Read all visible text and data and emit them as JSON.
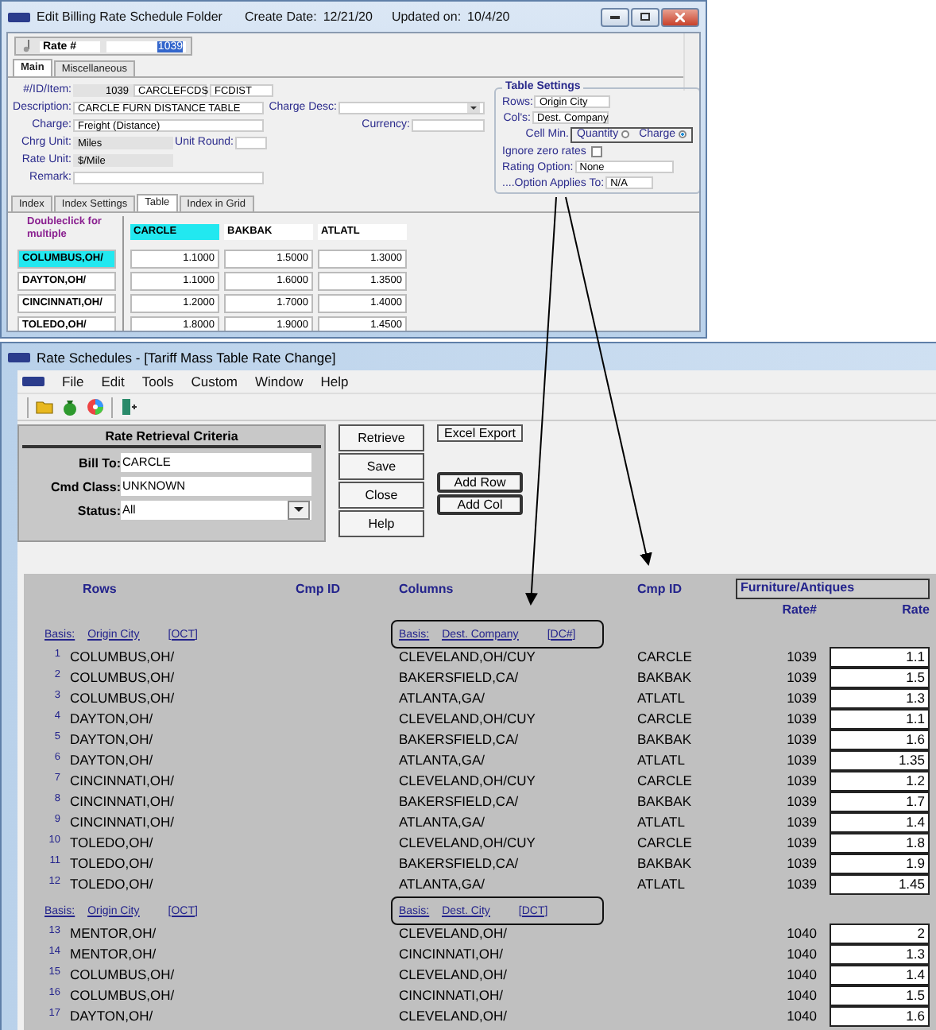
{
  "edit_window": {
    "title": "Edit Billing Rate Schedule Folder",
    "create_label": "Create Date:",
    "create_date": "12/21/20",
    "updated_label": "Updated on:",
    "updated_date": "10/4/20",
    "rate_label": "Rate #",
    "rate_value": "1039",
    "tabs": [
      {
        "label": "Main",
        "selected": true
      },
      {
        "label": "Miscellaneous",
        "selected": false
      }
    ],
    "id_item": {
      "label": "#/ID/Item:",
      "number": "1039",
      "code": "CARCLEFCDS",
      "item": "FCDIST"
    },
    "description": {
      "label": "Description:",
      "value": "CARCLE FURN DISTANCE TABLE"
    },
    "charge_desc": {
      "label": "Charge Desc:"
    },
    "charge": {
      "label": "Charge:",
      "value": "Freight (Distance)"
    },
    "currency": {
      "label": "Currency:"
    },
    "chrg_unit": {
      "label": "Chrg Unit:",
      "value": "Miles"
    },
    "unit_round": {
      "label": "Unit Round:"
    },
    "rate_unit": {
      "label": "Rate Unit:",
      "value": "$/Mile"
    },
    "remark": {
      "label": "Remark:"
    },
    "table_settings": {
      "title": "Table Settings",
      "rows_label": "Rows:",
      "rows_value": "Origin City",
      "cols_label": "Col's:",
      "cols_value": "Dest. Company",
      "cell_min_label": "Cell Min.",
      "cell_min_options": [
        {
          "label": "Quantity",
          "selected": false
        },
        {
          "label": "Charge",
          "selected": true
        }
      ],
      "ignore_zero": {
        "label": "Ignore zero rates",
        "checked": false
      },
      "rating_option": {
        "label": "Rating Option:",
        "value": "None"
      },
      "option_applies": {
        "label": "....Option Applies To:",
        "value": "N/A"
      }
    },
    "lower_tabs": [
      {
        "label": "Index",
        "selected": false
      },
      {
        "label": "Index Settings",
        "selected": false
      },
      {
        "label": "Table",
        "selected": true
      },
      {
        "label": "Index in Grid",
        "selected": false
      }
    ],
    "grid": {
      "hint": "Doubleclick for multiple",
      "columns": [
        {
          "label": "CARCLE",
          "selected": true
        },
        {
          "label": "BAKBAK",
          "selected": false
        },
        {
          "label": "ATLATL",
          "selected": false
        }
      ],
      "rows": [
        {
          "label": "COLUMBUS,OH/",
          "selected": true,
          "values": [
            "1.1000",
            "1.5000",
            "1.3000"
          ]
        },
        {
          "label": "DAYTON,OH/",
          "selected": false,
          "values": [
            "1.1000",
            "1.6000",
            "1.3500"
          ]
        },
        {
          "label": "CINCINNATI,OH/",
          "selected": false,
          "values": [
            "1.2000",
            "1.7000",
            "1.4000"
          ]
        },
        {
          "label": "TOLEDO,OH/",
          "selected": false,
          "values": [
            "1.8000",
            "1.9000",
            "1.4500"
          ]
        }
      ]
    }
  },
  "rate_window": {
    "title": "Rate Schedules - [Tariff Mass Table Rate Change]",
    "menu": [
      "File",
      "Edit",
      "Tools",
      "Custom",
      "Window",
      "Help"
    ],
    "criteria": {
      "title": "Rate Retrieval Criteria",
      "bill_to": {
        "label": "Bill To:",
        "value": "CARCLE"
      },
      "cmd_class": {
        "label": "Cmd Class:",
        "value": "UNKNOWN"
      },
      "status": {
        "label": "Status:",
        "value": "All"
      }
    },
    "buttons_left": [
      {
        "label": "Retrieve",
        "emphasized": false
      },
      {
        "label": "Save",
        "emphasized": false
      },
      {
        "label": "Close",
        "emphasized": false
      },
      {
        "label": "Help",
        "emphasized": false
      }
    ],
    "buttons_right": [
      {
        "label": "Excel Export",
        "emphasized": false
      },
      {
        "label": "Add Row",
        "emphasized": true
      },
      {
        "label": "Add Col",
        "emphasized": true
      }
    ],
    "headers": {
      "rows": "Rows",
      "cmp_id": "Cmp ID",
      "columns": "Columns",
      "cmp_id_2": "Cmp ID",
      "group": "Furniture/Antiques",
      "rate_no": "Rate#",
      "rate": "Rate"
    },
    "groups": [
      {
        "row_basis": {
          "label": "Basis:",
          "value": "Origin City",
          "code": "[OCT]"
        },
        "col_basis": {
          "label": "Basis:",
          "value": "Dest. Company",
          "code": "[DC#]",
          "outlined": true
        },
        "rows": [
          {
            "num": "1",
            "row": "COLUMBUS,OH/",
            "column": "CLEVELAND,OH/CUY",
            "cmp_id": "CARCLE",
            "rate_no": "1039",
            "rate": "1.1"
          },
          {
            "num": "2",
            "row": "COLUMBUS,OH/",
            "column": "BAKERSFIELD,CA/",
            "cmp_id": "BAKBAK",
            "rate_no": "1039",
            "rate": "1.5"
          },
          {
            "num": "3",
            "row": "COLUMBUS,OH/",
            "column": "ATLANTA,GA/",
            "cmp_id": "ATLATL",
            "rate_no": "1039",
            "rate": "1.3"
          },
          {
            "num": "4",
            "row": "DAYTON,OH/",
            "column": "CLEVELAND,OH/CUY",
            "cmp_id": "CARCLE",
            "rate_no": "1039",
            "rate": "1.1"
          },
          {
            "num": "5",
            "row": "DAYTON,OH/",
            "column": "BAKERSFIELD,CA/",
            "cmp_id": "BAKBAK",
            "rate_no": "1039",
            "rate": "1.6"
          },
          {
            "num": "6",
            "row": "DAYTON,OH/",
            "column": "ATLANTA,GA/",
            "cmp_id": "ATLATL",
            "rate_no": "1039",
            "rate": "1.35"
          },
          {
            "num": "7",
            "row": "CINCINNATI,OH/",
            "column": "CLEVELAND,OH/CUY",
            "cmp_id": "CARCLE",
            "rate_no": "1039",
            "rate": "1.2"
          },
          {
            "num": "8",
            "row": "CINCINNATI,OH/",
            "column": "BAKERSFIELD,CA/",
            "cmp_id": "BAKBAK",
            "rate_no": "1039",
            "rate": "1.7"
          },
          {
            "num": "9",
            "row": "CINCINNATI,OH/",
            "column": "ATLANTA,GA/",
            "cmp_id": "ATLATL",
            "rate_no": "1039",
            "rate": "1.4"
          },
          {
            "num": "10",
            "row": "TOLEDO,OH/",
            "column": "CLEVELAND,OH/CUY",
            "cmp_id": "CARCLE",
            "rate_no": "1039",
            "rate": "1.8"
          },
          {
            "num": "11",
            "row": "TOLEDO,OH/",
            "column": "BAKERSFIELD,CA/",
            "cmp_id": "BAKBAK",
            "rate_no": "1039",
            "rate": "1.9"
          },
          {
            "num": "12",
            "row": "TOLEDO,OH/",
            "column": "ATLANTA,GA/",
            "cmp_id": "ATLATL",
            "rate_no": "1039",
            "rate": "1.45"
          }
        ]
      },
      {
        "row_basis": {
          "label": "Basis:",
          "value": "Origin City",
          "code": "[OCT]"
        },
        "col_basis": {
          "label": "Basis:",
          "value": "Dest. City",
          "code": "[DCT]",
          "outlined": true
        },
        "rows": [
          {
            "num": "13",
            "row": "MENTOR,OH/",
            "column": "CLEVELAND,OH/",
            "rate_no": "1040",
            "rate": "2"
          },
          {
            "num": "14",
            "row": "MENTOR,OH/",
            "column": "CINCINNATI,OH/",
            "rate_no": "1040",
            "rate": "1.3"
          },
          {
            "num": "15",
            "row": "COLUMBUS,OH/",
            "column": "CLEVELAND,OH/",
            "rate_no": "1040",
            "rate": "1.4"
          },
          {
            "num": "16",
            "row": "COLUMBUS,OH/",
            "column": "CINCINNATI,OH/",
            "rate_no": "1040",
            "rate": "1.5"
          },
          {
            "num": "17",
            "row": "DAYTON,OH/",
            "column": "CLEVELAND,OH/",
            "rate_no": "1040",
            "rate": "1.6"
          }
        ]
      }
    ]
  }
}
